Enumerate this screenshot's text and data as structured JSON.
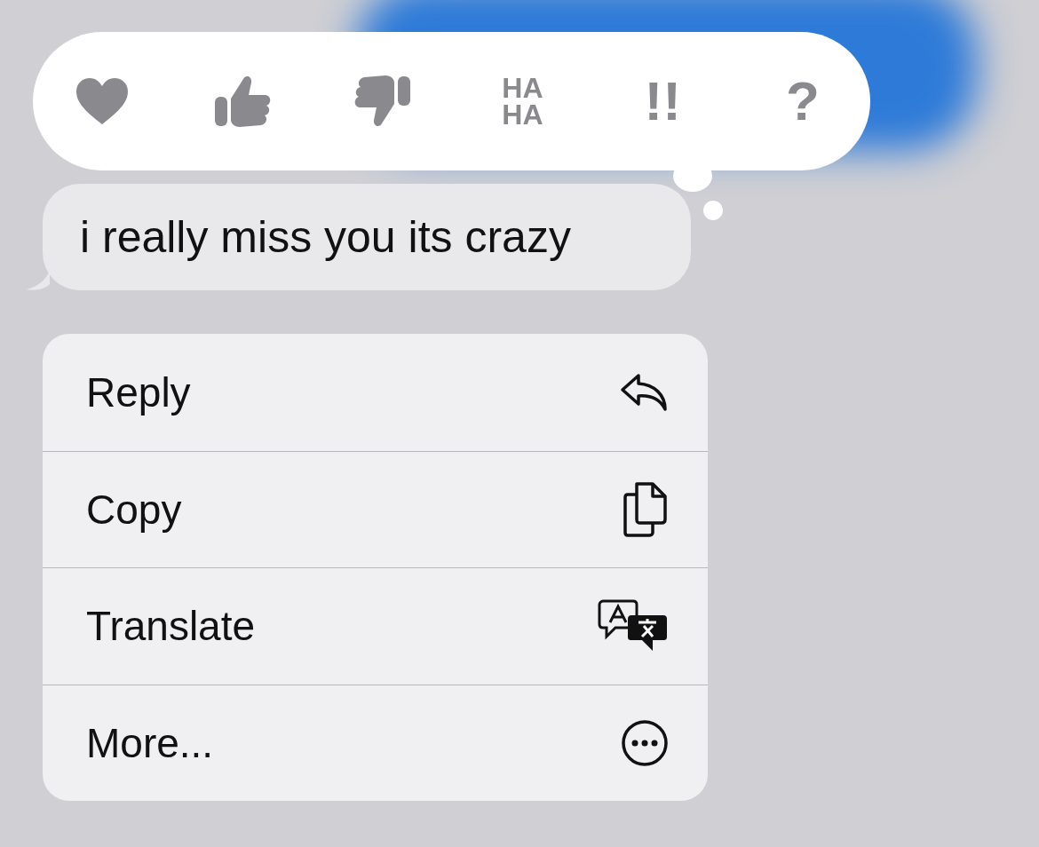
{
  "tapbacks": [
    {
      "kind": "heart"
    },
    {
      "kind": "thumbs-up"
    },
    {
      "kind": "thumbs-down"
    },
    {
      "kind": "text",
      "label": "HA HA"
    },
    {
      "kind": "text",
      "label": "!!"
    },
    {
      "kind": "text",
      "label": "?"
    }
  ],
  "message": {
    "text": "i really miss you its crazy"
  },
  "menu": [
    {
      "label": "Reply",
      "kind": "reply"
    },
    {
      "label": "Copy",
      "kind": "copy"
    },
    {
      "label": "Translate",
      "kind": "translate"
    },
    {
      "label": "More...",
      "kind": "more"
    }
  ]
}
